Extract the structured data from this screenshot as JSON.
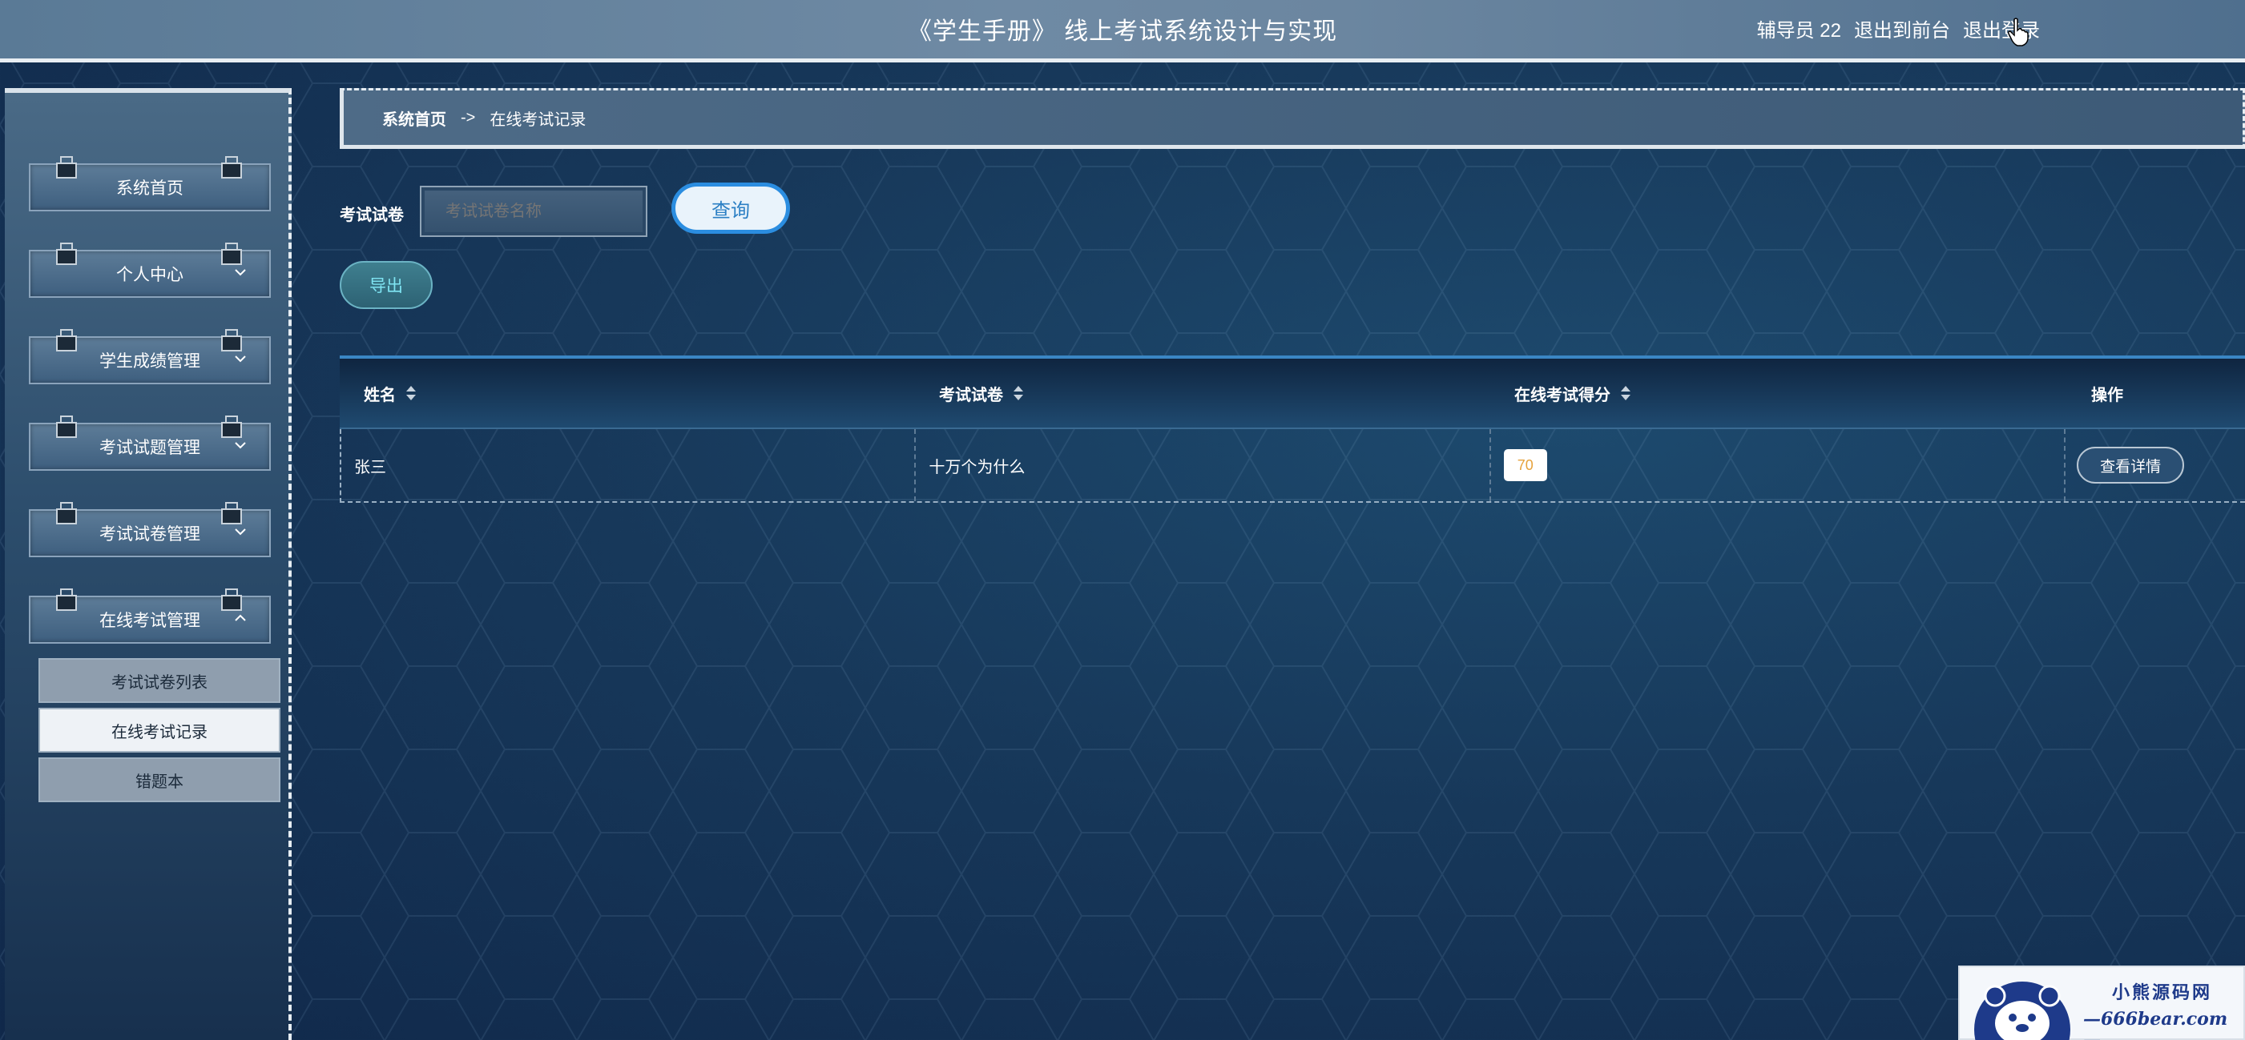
{
  "header": {
    "title": "《学生手册》 线上考试系统设计与实现",
    "user_label": "辅导员 22",
    "exit_front": "退出到前台",
    "logout": "退出登录"
  },
  "sidebar": {
    "items": [
      {
        "label": "系统首页",
        "expandable": false
      },
      {
        "label": "个人中心",
        "expandable": true,
        "expanded": false
      },
      {
        "label": "学生成绩管理",
        "expandable": true,
        "expanded": false
      },
      {
        "label": "考试试题管理",
        "expandable": true,
        "expanded": false
      },
      {
        "label": "考试试卷管理",
        "expandable": true,
        "expanded": false
      },
      {
        "label": "在线考试管理",
        "expandable": true,
        "expanded": true
      }
    ],
    "submenu": [
      {
        "label": "考试试卷列表",
        "active": false
      },
      {
        "label": "在线考试记录",
        "active": true
      },
      {
        "label": "错题本",
        "active": false
      }
    ]
  },
  "breadcrumb": {
    "home": "系统首页",
    "separator": "->",
    "current": "在线考试记录"
  },
  "search": {
    "label": "考试试卷",
    "placeholder": "考试试卷名称",
    "query_button": "查询",
    "export_button": "导出"
  },
  "table": {
    "columns": [
      "姓名",
      "考试试卷",
      "在线考试得分",
      "操作"
    ],
    "rows": [
      {
        "name": "张三",
        "paper": "十万个为什么",
        "score": "70",
        "action": "查看详情"
      }
    ]
  },
  "watermark": {
    "line1": "小熊源码网",
    "line2": "—666bear.com—"
  },
  "colors": {
    "accent": "#2b8de0",
    "score_text": "#e6a23c",
    "export_text": "#7fe4f2"
  }
}
